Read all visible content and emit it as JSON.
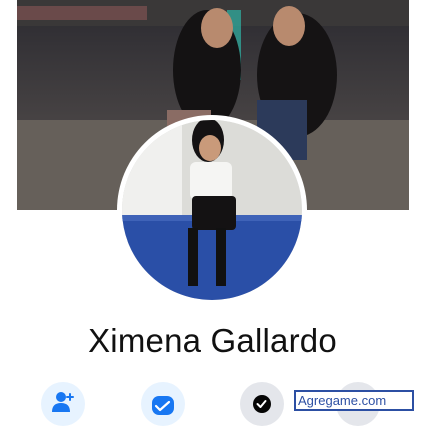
{
  "profile": {
    "name": "Ximena Gallardo"
  },
  "actions": [
    {
      "id": "add-friend",
      "icon": "add-friend-icon",
      "color": "#1877f2"
    },
    {
      "id": "message",
      "icon": "messenger-icon",
      "color": "#1877f2"
    },
    {
      "id": "more",
      "icon": "more-icon",
      "color": "#050505"
    }
  ],
  "watermark": {
    "text": "Agregame.com"
  },
  "colors": {
    "accent": "#1877f2",
    "action_bg": "#e7f3ff",
    "watermark": "#2c4fa3"
  }
}
